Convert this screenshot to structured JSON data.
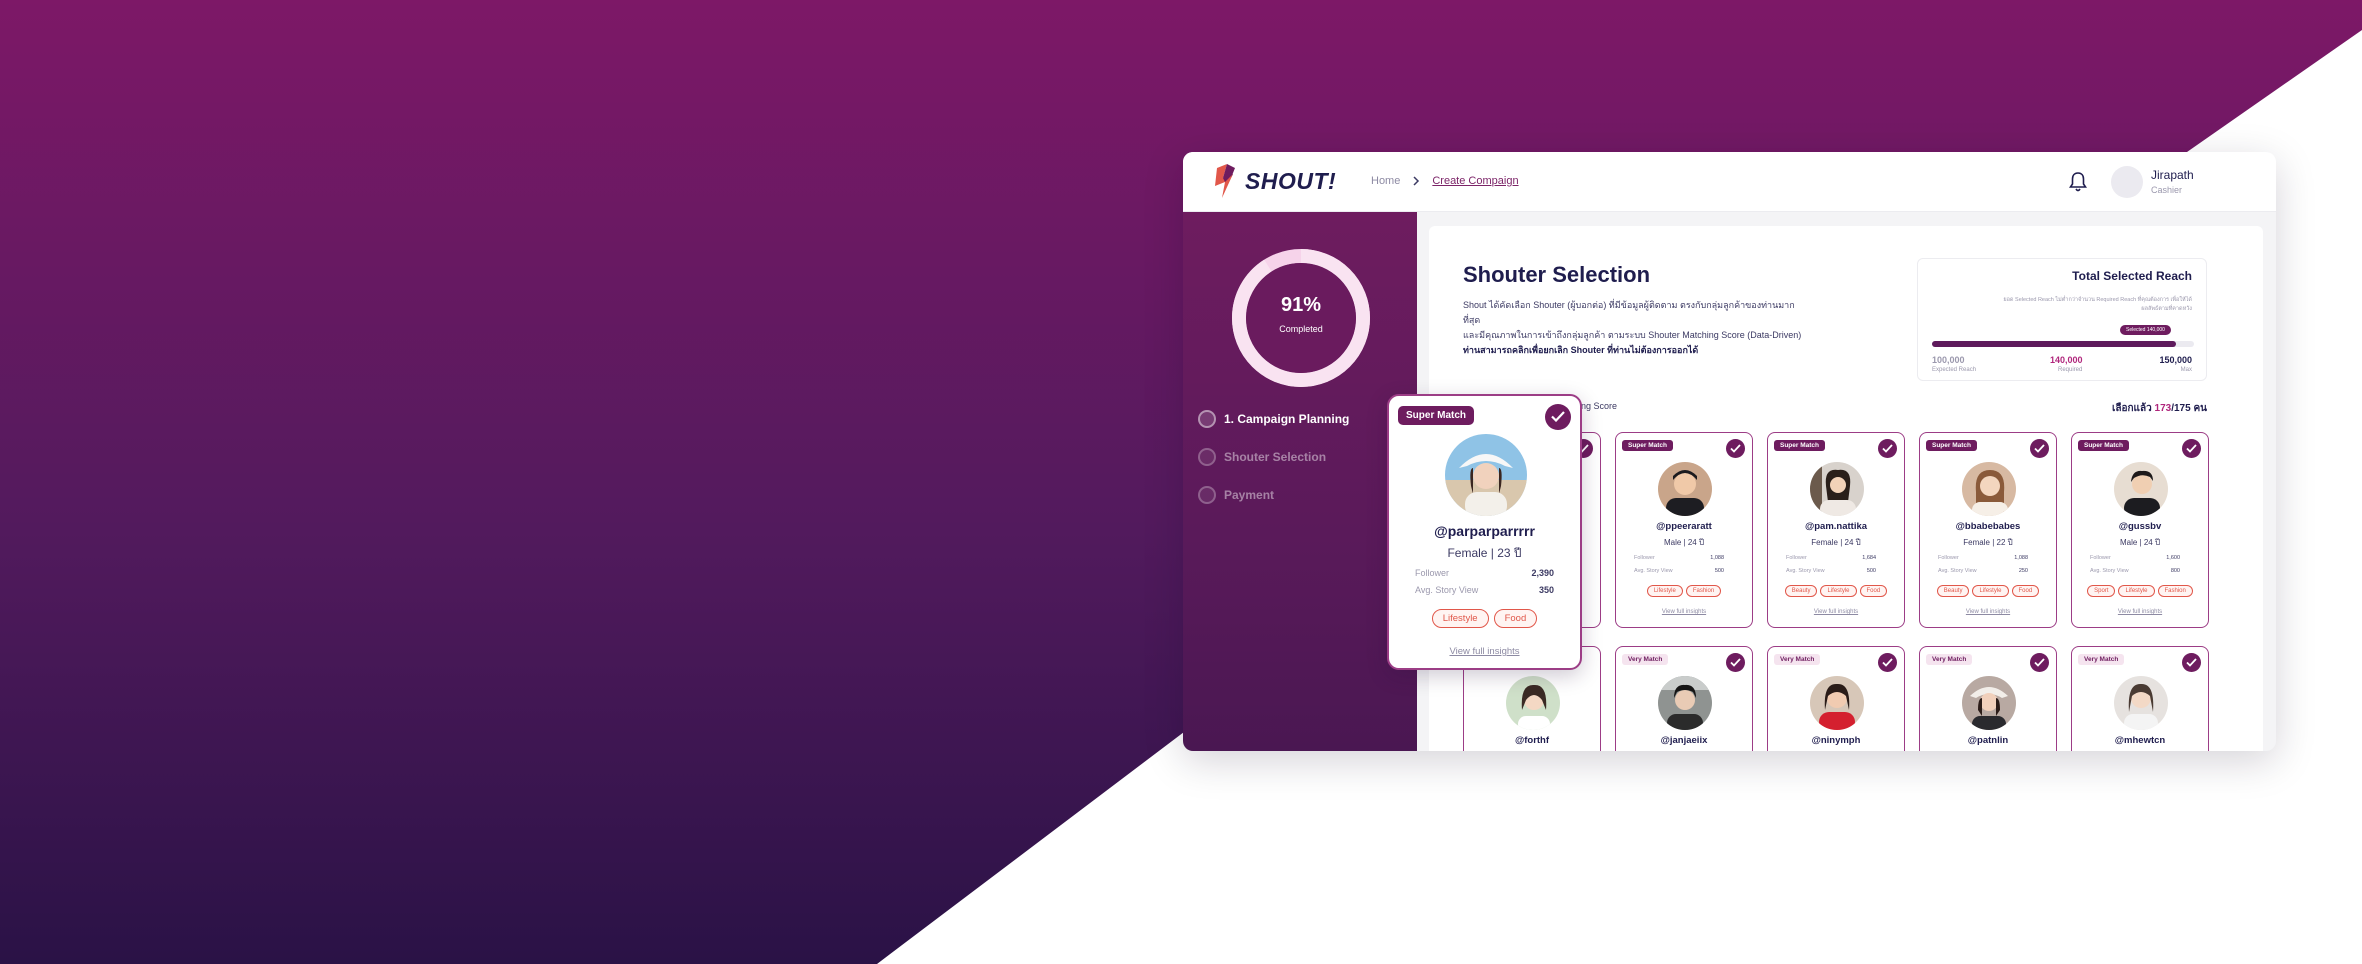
{
  "colors": {
    "bg_top": "#7d1867",
    "bg_bottom": "#2a1246",
    "brand": "#6e1c5f",
    "accent": "#b0267c",
    "tag": "#e1574a"
  },
  "header": {
    "logo_text": "SHOUT!",
    "breadcrumb": {
      "home": "Home",
      "current": "Create Compaign"
    },
    "user": {
      "name": "Jirapath",
      "role": "Cashier"
    },
    "icons": [
      "bell-icon",
      "chevron-right-icon"
    ]
  },
  "sidebar": {
    "progress": {
      "percent": 0.91,
      "label": "91%",
      "caption": "Completed"
    },
    "steps": [
      {
        "label": "1. Campaign Planning",
        "state": "active"
      },
      {
        "label": "Shouter Selection",
        "state": "pending"
      },
      {
        "label": "Payment",
        "state": "pending"
      }
    ]
  },
  "main": {
    "title": "Shouter Selection",
    "desc_line1": "Shout ได้คัดเลือก Shouter (ผู้บอกต่อ) ที่มีข้อมูลผู้ติดตาม ตรงกับกลุ่มลูกค้าของท่านมากที่สุด",
    "desc_line2": "และมีคุณภาพในการเข้าถึงกลุ่มลูกค้า ตามระบบ Shouter Matching Score (Data-Driven)",
    "desc_line3": "ท่านสามารถคลิกเพื่อยกเลิก Shouter ที่ท่านไม่ต้องการออกได้",
    "sort_label": "tching Score",
    "selected_prefix": "เลือกแล้ว",
    "selected_count": "173",
    "selected_total": "/175 คน"
  },
  "reach": {
    "title": "Total Selected Reach",
    "note": "ยอด Selected Reach ไม่ต่ำกว่าจำนวน Required Reach ที่คุณต้องการ เพื่อให้ได้ผลลัพธ์ตามที่คาดหวัง",
    "pill": "Selected 140,000",
    "fill_percent": 0.93,
    "expected_value": "100,000",
    "expected_label": "Expected Reach",
    "required_value": "140,000",
    "required_label": "Required",
    "max_value": "150,000",
    "max_label": "Max"
  },
  "labels": {
    "follower": "Follower",
    "story_view": "Avg. Story View",
    "insights": "View full insights"
  },
  "row1": [
    {
      "badge": "Super Match",
      "handle": "@ppeeraratt",
      "meta": "Male | 24 ปี",
      "follower": "1,088",
      "story": "500",
      "tags": [
        "Lifestyle",
        "Fashion"
      ]
    },
    {
      "badge": "Super Match",
      "handle": "@pam.nattika",
      "meta": "Female | 24 ปี",
      "follower": "1,684",
      "story": "500",
      "tags": [
        "Beauty",
        "Lifestyle",
        "Food"
      ]
    },
    {
      "badge": "Super Match",
      "handle": "@bbabebabes",
      "meta": "Female | 22 ปี",
      "follower": "1,088",
      "story": "250",
      "tags": [
        "Beauty",
        "Lifestyle",
        "Food"
      ]
    },
    {
      "badge": "Super Match",
      "handle": "@gussbv",
      "meta": "Male | 24 ปี",
      "follower": "1,600",
      "story": "800",
      "tags": [
        "Sport",
        "Lifestyle",
        "Fashion"
      ]
    }
  ],
  "row2": [
    {
      "badge": "",
      "handle": "@forthf"
    },
    {
      "badge": "Very Match",
      "handle": "@janjaeiix"
    },
    {
      "badge": "Very Match",
      "handle": "@ninymph"
    },
    {
      "badge": "Very Match",
      "handle": "@patnlin"
    },
    {
      "badge": "Very Match",
      "handle": "@mhewtcn"
    }
  ],
  "popup": {
    "badge": "Super Match",
    "handle": "@parparparrrrr",
    "meta": "Female | 23 ปี",
    "follower": "2,390",
    "story": "350",
    "tags": [
      "Lifestyle",
      "Food"
    ]
  }
}
